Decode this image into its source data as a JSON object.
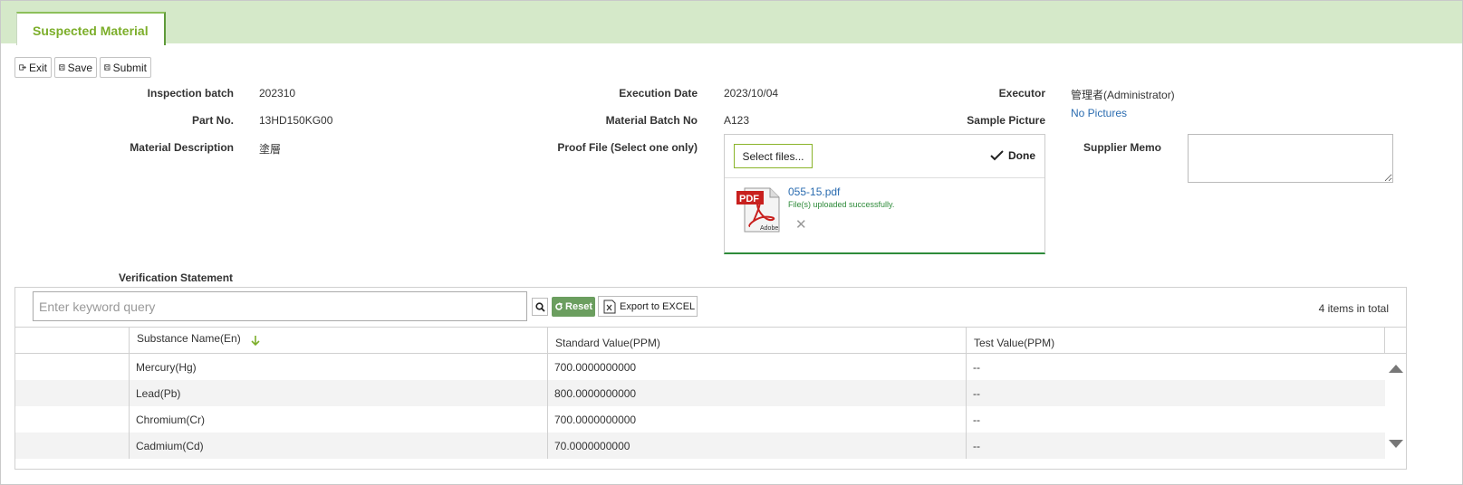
{
  "tab": {
    "label": "Suspected Material"
  },
  "toolbar": {
    "exit_label": "Exit",
    "save_label": "Save",
    "submit_label": "Submit"
  },
  "form": {
    "inspection_batch_label": "Inspection batch",
    "inspection_batch_value": "202310",
    "execution_date_label": "Execution Date",
    "execution_date_value": "2023/10/04",
    "executor_label": "Executor",
    "executor_value": "管理者(Administrator)",
    "part_no_label": "Part No.",
    "part_no_value": "13HD150KG00",
    "material_batch_label": "Material Batch No",
    "material_batch_value": "A123",
    "sample_picture_label": "Sample Picture",
    "sample_picture_value": "No Pictures",
    "material_desc_label": "Material Description",
    "material_desc_value": "塗層",
    "proof_file_label": "Proof File (Select one only)",
    "supplier_memo_label": "Supplier Memo",
    "verification_label": "Verification Statement"
  },
  "upload": {
    "select_label": "Select files...",
    "done_label": "Done",
    "file_name": "055-15.pdf",
    "file_status": "File(s) uploaded successfully."
  },
  "grid": {
    "search_placeholder": "Enter keyword query",
    "reset_label": "Reset",
    "export_label": "Export to EXCEL",
    "total_label": "4 items in total",
    "columns": [
      "Substance Name(En)",
      "Standard Value(PPM)",
      "Test Value(PPM)"
    ],
    "rows": [
      {
        "name": "Mercury(Hg)",
        "standard": "700.0000000000",
        "test": "--"
      },
      {
        "name": "Lead(Pb)",
        "standard": "800.0000000000",
        "test": "--"
      },
      {
        "name": "Chromium(Cr)",
        "standard": "700.0000000000",
        "test": "--"
      },
      {
        "name": "Cadmium(Cd)",
        "standard": "70.0000000000",
        "test": "--"
      }
    ]
  },
  "colors": {
    "tab_accent": "#7cae2a",
    "tabbar_bg": "#d5e9c9",
    "reset_bg": "#6b9e5f",
    "link": "#2b6cb0"
  }
}
